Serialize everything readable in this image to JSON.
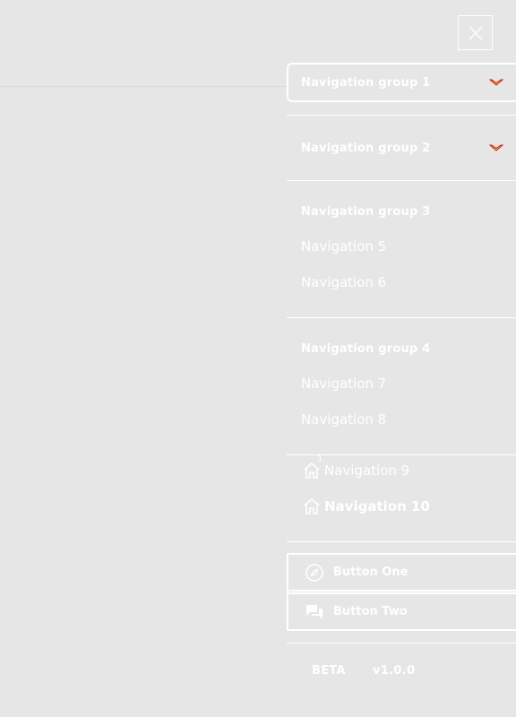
{
  "header": {
    "close_icon": "close-icon"
  },
  "drawer": {
    "groups": [
      {
        "label": "Navigation group 1",
        "icon": "chevron-down-icon",
        "chevron_color": "#cc1a1a",
        "chevron_fill": "#ffcc00"
      },
      {
        "label": "Navigation group 2",
        "icon": "chevron-down-icon",
        "chevron_color": "#cc1a1a",
        "chevron_fill": "#ffcc00"
      }
    ],
    "section3": {
      "heading": "Navigation group 3",
      "links": [
        "Navigation 5",
        "Navigation 6"
      ]
    },
    "section4": {
      "heading": "Navigation group 4",
      "links": [
        "Navigation 7",
        "Navigation 8"
      ]
    },
    "icon_links": [
      {
        "label": "Navigation 9",
        "icon": "home-icon",
        "badge": "1"
      },
      {
        "label": "Navigation 10",
        "icon": "home-icon",
        "active": true
      }
    ],
    "buttons": [
      {
        "label": "Button One",
        "icon": "compass-icon"
      },
      {
        "label": "Button Two",
        "icon": "chat-icon"
      }
    ],
    "footer": {
      "beta": "BETA",
      "version": "v1.0.0"
    }
  }
}
